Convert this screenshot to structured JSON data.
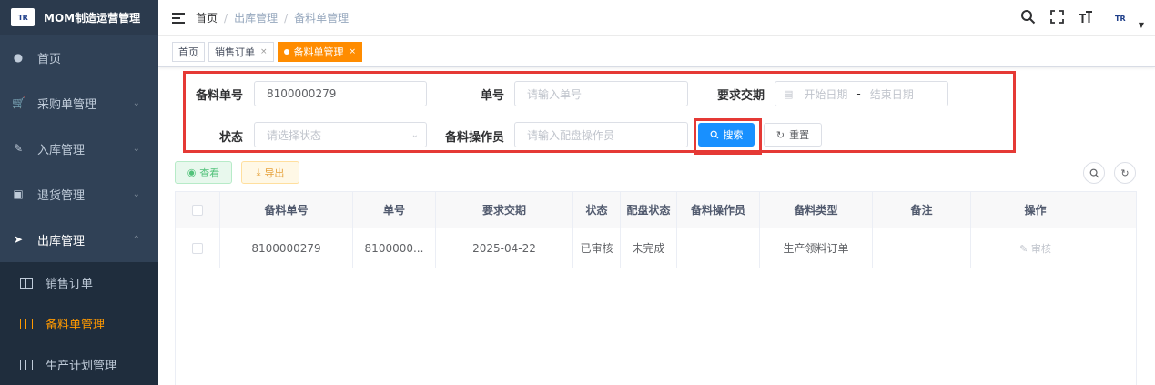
{
  "app": {
    "logo_text": "TR",
    "title": "MOM制造运营管理"
  },
  "sidebar": {
    "items": [
      {
        "label": "首页",
        "icon": "dashboard-icon",
        "has_children": false
      },
      {
        "label": "采购单管理",
        "icon": "cart-icon",
        "has_children": true
      },
      {
        "label": "入库管理",
        "icon": "edit-box-icon",
        "has_children": true
      },
      {
        "label": "退货管理",
        "icon": "return-icon",
        "has_children": true
      },
      {
        "label": "出库管理",
        "icon": "send-icon",
        "has_children": true,
        "expanded": true
      }
    ],
    "submenu": [
      {
        "label": "销售订单",
        "active": false
      },
      {
        "label": "备料单管理",
        "active": true
      },
      {
        "label": "生产计划管理",
        "active": false
      }
    ],
    "colors": {
      "bg": "#304156",
      "active": "#ff9900"
    }
  },
  "header": {
    "breadcrumb": [
      "首页",
      "出库管理",
      "备料单管理"
    ],
    "icons": [
      "search-icon",
      "fullscreen-icon",
      "font-size-icon",
      "avatar-logo"
    ]
  },
  "tags": [
    {
      "label": "首页",
      "active": false,
      "closable": false
    },
    {
      "label": "销售订单",
      "active": false,
      "closable": true
    },
    {
      "label": "备料单管理",
      "active": true,
      "closable": true
    }
  ],
  "search": {
    "fields": {
      "prep_no": {
        "label": "备料单号",
        "value": "8100000279",
        "placeholder": ""
      },
      "order_no": {
        "label": "单号",
        "value": "",
        "placeholder": "请输入单号"
      },
      "due_date": {
        "label": "要求交期",
        "start_placeholder": "开始日期",
        "separator": "-",
        "end_placeholder": "结束日期"
      },
      "status": {
        "label": "状态",
        "placeholder": "请选择状态"
      },
      "operator": {
        "label": "备料操作员",
        "value": "",
        "placeholder": "请输入配盘操作员"
      }
    },
    "search_button": "搜索",
    "reset_button": "重置"
  },
  "toolbar": {
    "view_label": "查看",
    "export_label": "导出"
  },
  "table": {
    "columns": [
      "备料单号",
      "单号",
      "要求交期",
      "状态",
      "配盘状态",
      "备料操作员",
      "备料类型",
      "备注",
      "操作"
    ],
    "rows": [
      {
        "prep_no": "8100000279",
        "order_no": "8100000...",
        "due_date": "2025-04-22",
        "status": "已审核",
        "tray_status": "未完成",
        "operator": "",
        "prep_type": "生产领料订单",
        "remark": "",
        "action": "审核"
      }
    ]
  },
  "colors": {
    "primary": "#1890ff",
    "accent": "#ff8c00",
    "highlight_border": "#e53935"
  }
}
